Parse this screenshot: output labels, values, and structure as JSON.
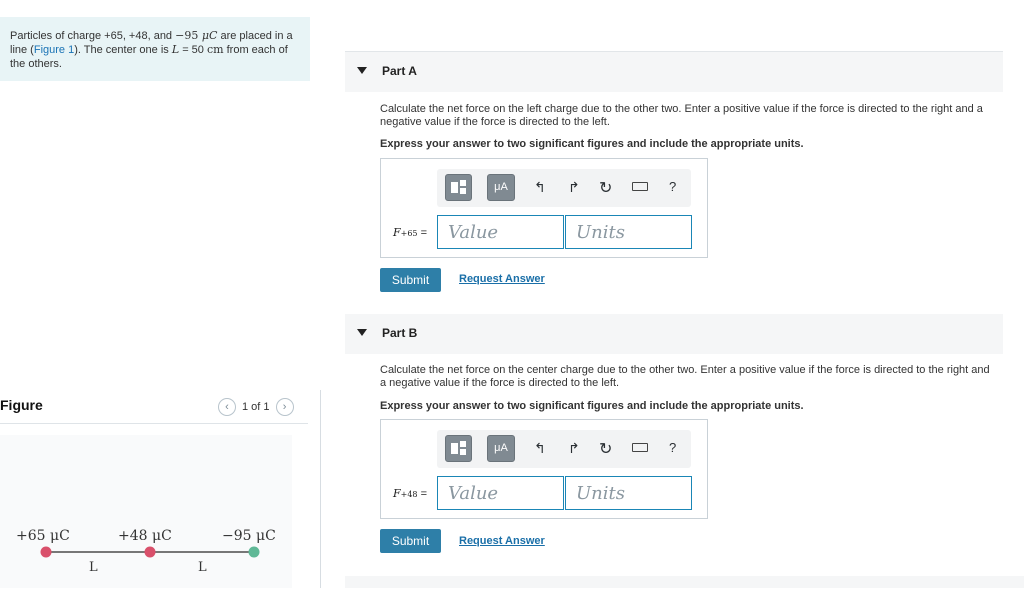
{
  "problem": {
    "intro_pre": "Particles of charge +65, +48, and ",
    "intro_neg": "−95",
    "intro_unit": " μC",
    "intro_mid": " are placed in a line (",
    "figure_link": "Figure 1",
    "intro_post": "). The center one is ",
    "L_sym": "L",
    "L_eq": " = 50 ",
    "L_unit": "cm",
    "intro_end": " from each of the others."
  },
  "figure": {
    "title": "Figure",
    "pager": "1 of 1",
    "prev_icon": "chevron-left-icon",
    "next_icon": "chevron-right-icon",
    "labels": {
      "q1": "+65 μC",
      "q2": "+48 μC",
      "q3": "−95 μC",
      "L1": "L",
      "L2": "L"
    },
    "colors": {
      "q1": "#d9506b",
      "q2": "#d9506b",
      "q3": "#5fb896",
      "line": "#777777"
    }
  },
  "parts": [
    {
      "title": "Part A",
      "question": "Calculate the net force on the left charge due to the other two. Enter a positive value if the force is directed to the right and a negative value if the force is directed to the left.",
      "instruction": "Express your answer to two significant figures and include the appropriate units.",
      "var_main": "F",
      "var_sub": "+65",
      "var_eq": " =",
      "value_placeholder": "Value",
      "units_placeholder": "Units",
      "submit_label": "Submit",
      "request_label": "Request Answer"
    },
    {
      "title": "Part B",
      "question": "Calculate the net force on the center charge due to the other two. Enter a positive value if the force is directed to the right and a negative value if the force is directed to the left.",
      "instruction": "Express your answer to two significant figures and include the appropriate units.",
      "var_main": "F",
      "var_sub": "+48",
      "var_eq": " =",
      "value_placeholder": "Value",
      "units_placeholder": "Units",
      "submit_label": "Submit",
      "request_label": "Request Answer"
    }
  ],
  "toolbar": {
    "units_button": "μA",
    "help": "?",
    "icons": [
      "templates-icon",
      "units-icon",
      "undo-icon",
      "redo-icon",
      "reset-icon",
      "keyboard-icon",
      "help-icon"
    ]
  },
  "colors": {
    "accent": "#2e7fa8",
    "intro_bg": "#e8f4f6",
    "link": "#1a73b5"
  }
}
